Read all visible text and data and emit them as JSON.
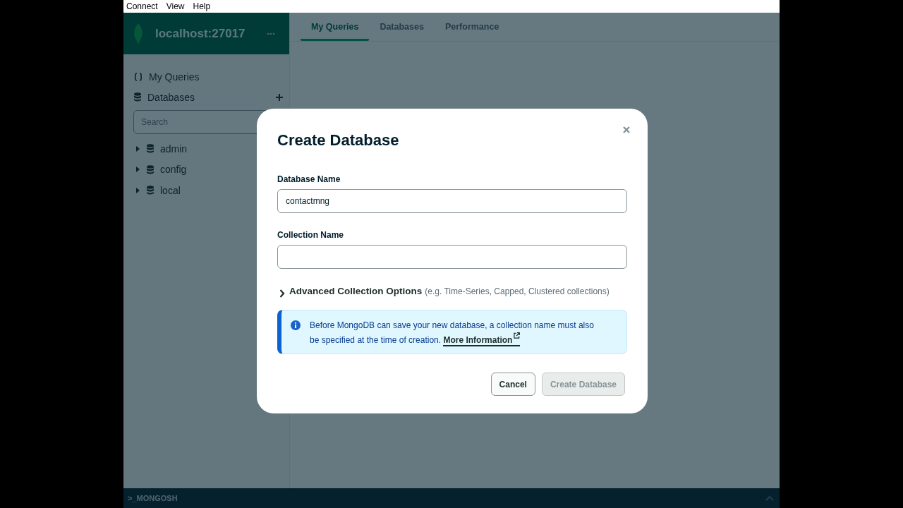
{
  "menu_bar": [
    {
      "label": "Connect"
    },
    {
      "label": "View"
    },
    {
      "label": "Help"
    }
  ],
  "sidebar": {
    "connection": "localhost:27017",
    "nav": [
      {
        "label": "My Queries",
        "kind": "queries"
      },
      {
        "label": "Databases",
        "kind": "databases"
      }
    ],
    "search": {
      "placeholder": "Search"
    },
    "databases": [
      {
        "name": "admin",
        "expanded": false
      },
      {
        "name": "config",
        "expanded": false
      },
      {
        "name": "local",
        "expanded": false
      }
    ]
  },
  "tabs": [
    {
      "label": "My Queries",
      "selected": true
    },
    {
      "label": "Databases",
      "selected": false
    },
    {
      "label": "Performance",
      "selected": false
    }
  ],
  "modal": {
    "title": "Create Database",
    "fields": [
      {
        "label": "Database Name",
        "value": "contactmng"
      },
      {
        "label": "Collection Name"
      }
    ],
    "advanced": {
      "label": "Advanced Collection Options",
      "hint": "(e.g. Time-Series, Capped, Clustered collections)",
      "expanded": false
    },
    "info": {
      "text": "Before MongoDB can save your new database, a collection name must also be specified at the time of creation.",
      "link": "More Information"
    },
    "buttons": [
      {
        "label": "Cancel",
        "disabled": false
      },
      {
        "label": "Create Database",
        "disabled": true
      }
    ]
  },
  "shell": {
    "label": ">_MONGOSH"
  }
}
